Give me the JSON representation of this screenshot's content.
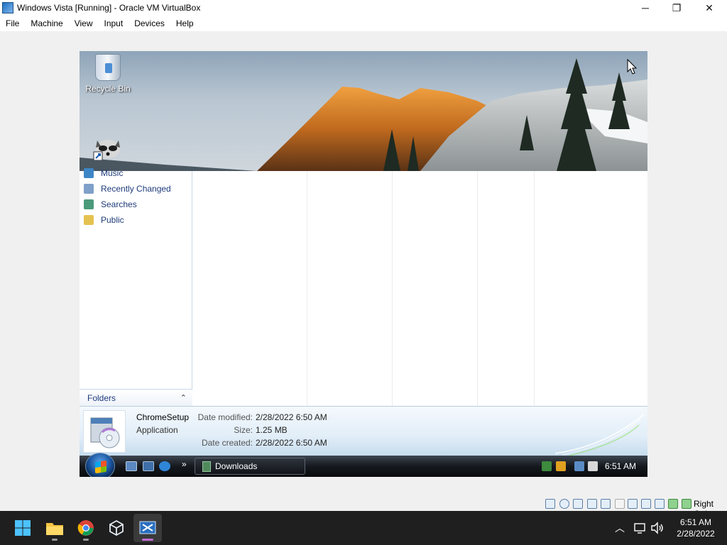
{
  "window": {
    "title": "Windows Vista [Running] - Oracle VM VirtualBox",
    "minimize_glyph": "─",
    "restore_glyph": "❐",
    "close_glyph": "✕"
  },
  "menu": [
    "File",
    "Machine",
    "View",
    "Input",
    "Devices",
    "Help"
  ],
  "guest": {
    "desktop_icons": [
      {
        "label": "Recycle Bin",
        "icon": "recycle-bin-icon"
      },
      {
        "label": "",
        "icon": "raccoon-shortcut-icon"
      }
    ],
    "nav_items": [
      {
        "label": "Music",
        "icon": "music-folder-icon",
        "color": "#3d86c6"
      },
      {
        "label": "Recently Changed",
        "icon": "recently-changed-icon",
        "color": "#7fa0c9"
      },
      {
        "label": "Searches",
        "icon": "searches-folder-icon",
        "color": "#4a9a7a"
      },
      {
        "label": "Public",
        "icon": "public-folder-icon",
        "color": "#e5c250"
      }
    ],
    "folders_label": "Folders",
    "folders_chevron": "⌃",
    "details": {
      "file_name": "ChromeSetup",
      "file_type": "Application",
      "date_modified_label": "Date modified:",
      "date_modified": "2/28/2022 6:50 AM",
      "size_label": "Size:",
      "size": "1.25 MB",
      "date_created_label": "Date created:",
      "date_created": "2/28/2022 6:50 AM"
    },
    "taskbar": {
      "more_glyph": "»",
      "task_label": "Downloads",
      "clock": "6:51 AM"
    }
  },
  "status_bar": {
    "host_key": "Right Ctrl"
  },
  "host_taskbar": {
    "tray_chevron": "︿",
    "time": "6:51 AM",
    "date": "2/28/2022"
  },
  "colors": {
    "vista_link": "#1e3b7a",
    "accent_pip": "#c46bd6"
  }
}
